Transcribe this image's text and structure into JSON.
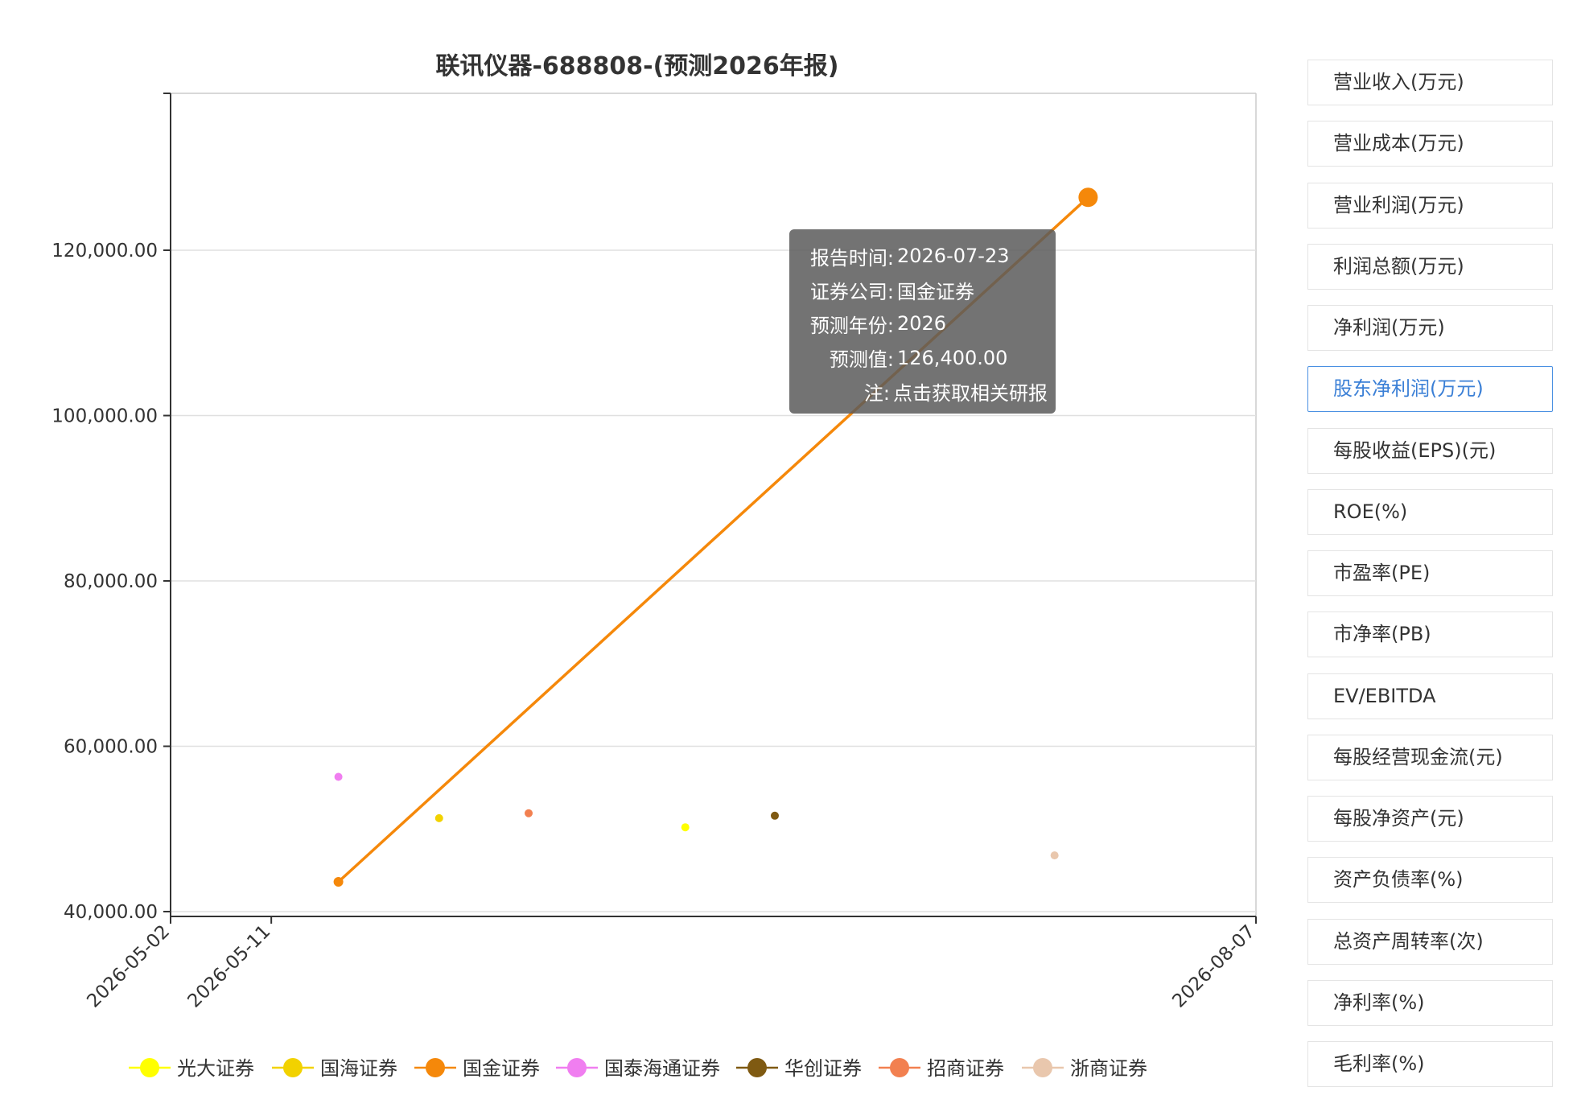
{
  "colors": {
    "axis": "#333333",
    "grid": "#e0e0e0",
    "highlight_line": "#f5880a",
    "menu_active": "#3a7fd6",
    "tooltip_bg": "#5a5a5a"
  },
  "chart_data": {
    "type": "scatter",
    "title": "联讯仪器-688808-(预测2026年报)",
    "xlabel": "",
    "ylabel": "",
    "x_ticks": [
      "2026-05-02",
      "2026-05-11",
      "2026-08-07"
    ],
    "xlim": [
      "2026-05-02",
      "2026-08-07"
    ],
    "y_ticks": [
      "40,000.00",
      "60,000.00",
      "80,000.00",
      "100,000.00",
      "120,000.00"
    ],
    "ylim": [
      40000,
      140000
    ],
    "grid": true,
    "legend_position": "bottom",
    "series": [
      {
        "name": "光大证券",
        "color": "#ffff00",
        "points": [
          {
            "x": "2026-06-17",
            "y": 50200
          }
        ]
      },
      {
        "name": "国海证券",
        "color": "#f2d200",
        "points": [
          {
            "x": "2026-05-26",
            "y": 51300
          }
        ]
      },
      {
        "name": "国金证券",
        "color": "#f5880a",
        "highlighted": true,
        "points": [
          {
            "x": "2026-05-17",
            "y": 43600
          },
          {
            "x": "2026-07-23",
            "y": 126400
          }
        ]
      },
      {
        "name": "国泰海通证券",
        "color": "#f07ef0",
        "points": [
          {
            "x": "2026-05-17",
            "y": 56300
          }
        ]
      },
      {
        "name": "华创证券",
        "color": "#7f5a12",
        "points": [
          {
            "x": "2026-06-25",
            "y": 51600
          }
        ]
      },
      {
        "name": "招商证券",
        "color": "#f28050",
        "points": [
          {
            "x": "2026-06-03",
            "y": 51900
          }
        ]
      },
      {
        "name": "浙商证券",
        "color": "#e9c7ad",
        "points": [
          {
            "x": "2026-07-20",
            "y": 46800
          }
        ]
      }
    ],
    "tooltip": {
      "report_time_label": "报告时间:",
      "report_time": "2026-07-23",
      "company_label": "证券公司:",
      "company": "国金证券",
      "year_label": "预测年份:",
      "year": "2026",
      "value_label": "预测值:",
      "value": "126,400.00",
      "note_label": "注:",
      "note": "点击获取相关研报"
    }
  },
  "menu": {
    "items": [
      {
        "label": "营业收入(万元)",
        "active": false,
        "icon": "none"
      },
      {
        "label": "营业成本(万元)",
        "active": false,
        "icon": "none"
      },
      {
        "label": "营业利润(万元)",
        "active": false,
        "icon": "none"
      },
      {
        "label": "利润总额(万元)",
        "active": false,
        "icon": "none"
      },
      {
        "label": "净利润(万元)",
        "active": false,
        "icon": "none"
      },
      {
        "label": "股东净利润(万元)",
        "active": true,
        "icon": "none"
      },
      {
        "label": "每股收益(EPS)(元)",
        "active": false,
        "icon": "none"
      },
      {
        "label": "ROE(%)",
        "active": false,
        "icon": "none"
      },
      {
        "label": "市盈率(PE)",
        "active": false,
        "icon": "none"
      },
      {
        "label": "市净率(PB)",
        "active": false,
        "icon": "none"
      },
      {
        "label": "EV/EBITDA",
        "active": false,
        "icon": "none"
      },
      {
        "label": "每股经营现金流(元)",
        "active": false,
        "icon": "none"
      },
      {
        "label": "每股净资产(元)",
        "active": false,
        "icon": "none"
      },
      {
        "label": "资产负债率(%)",
        "active": false,
        "icon": "none"
      },
      {
        "label": "总资产周转率(次)",
        "active": false,
        "icon": "none"
      },
      {
        "label": "净利率(%)",
        "active": false,
        "icon": "none"
      },
      {
        "label": "毛利率(%)",
        "active": false,
        "icon": "none"
      }
    ]
  }
}
